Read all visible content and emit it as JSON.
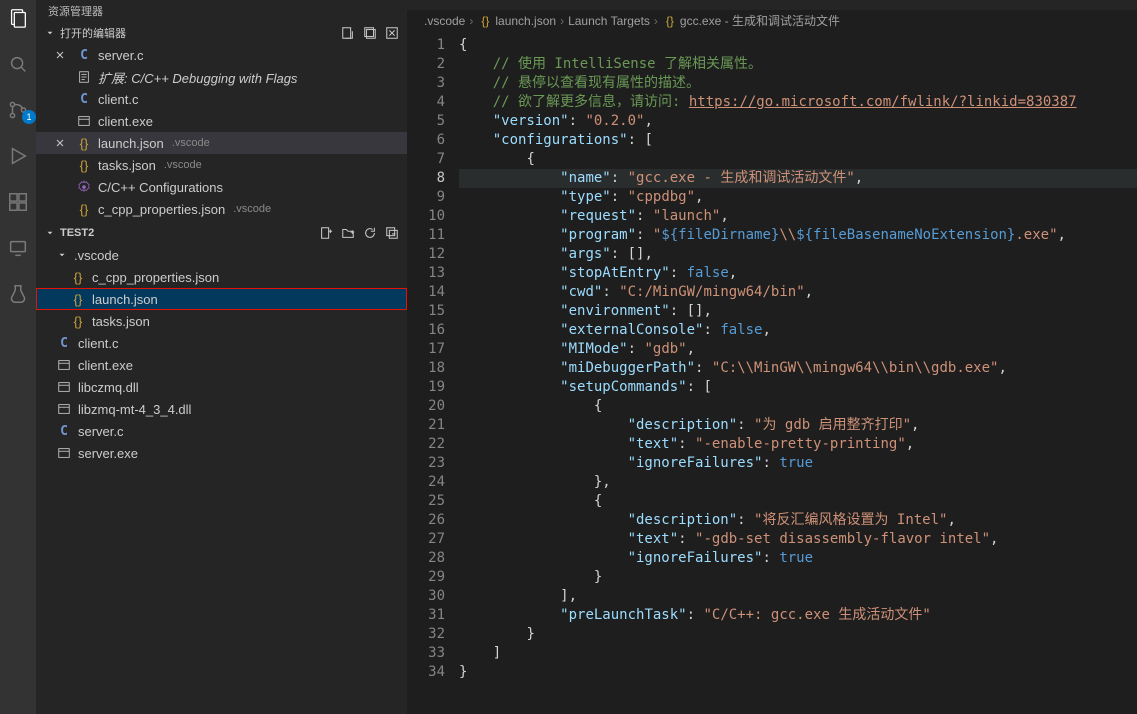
{
  "activity": {
    "badge_count": "1"
  },
  "sidebar": {
    "panel_title": "资源管理器",
    "open_editors_title": "打开的编辑器",
    "open_editors": [
      {
        "name": "server.c",
        "dim": "",
        "icon": "c",
        "close": true
      },
      {
        "name": "扩展: C/C++ Debugging with Flags",
        "dim": "",
        "icon": "md",
        "close": false,
        "italic": true
      },
      {
        "name": "client.c",
        "dim": "",
        "icon": "c",
        "close": false
      },
      {
        "name": "client.exe",
        "dim": "",
        "icon": "exe",
        "close": false
      },
      {
        "name": "launch.json",
        "dim": ".vscode",
        "icon": "json",
        "close": true,
        "active": true
      },
      {
        "name": "tasks.json",
        "dim": ".vscode",
        "icon": "json",
        "close": false
      },
      {
        "name": "C/C++ Configurations",
        "dim": "",
        "icon": "gear",
        "close": false
      },
      {
        "name": "c_cpp_properties.json",
        "dim": ".vscode",
        "icon": "json",
        "close": false
      }
    ],
    "folder_title": "TEST2",
    "tree": {
      "vscode": ".vscode",
      "items": [
        {
          "name": "c_cpp_properties.json",
          "icon": "json"
        },
        {
          "name": "launch.json",
          "icon": "json",
          "selected": true
        },
        {
          "name": "tasks.json",
          "icon": "json"
        }
      ],
      "root_items": [
        {
          "name": "client.c",
          "icon": "c"
        },
        {
          "name": "client.exe",
          "icon": "exe"
        },
        {
          "name": "libczmq.dll",
          "icon": "exe"
        },
        {
          "name": "libzmq-mt-4_3_4.dll",
          "icon": "exe"
        },
        {
          "name": "server.c",
          "icon": "c"
        },
        {
          "name": "server.exe",
          "icon": "exe"
        }
      ]
    }
  },
  "breadcrumbs": {
    "seg0": ".vscode",
    "seg1": "launch.json",
    "seg2": "Launch Targets",
    "seg3": "gcc.exe - 生成和调试活动文件"
  },
  "code": {
    "current_line": 8,
    "lines": [
      "{",
      "    // 使用 IntelliSense 了解相关属性。",
      "    // 悬停以查看现有属性的描述。",
      "    // 欲了解更多信息，请访问: https://go.microsoft.com/fwlink/?linkid=830387",
      "    \"version\": \"0.2.0\",",
      "    \"configurations\": [",
      "        {",
      "            \"name\": \"gcc.exe - 生成和调试活动文件\",",
      "            \"type\": \"cppdbg\",",
      "            \"request\": \"launch\",",
      "            \"program\": \"${fileDirname}\\\\${fileBasenameNoExtension}.exe\",",
      "            \"args\": [],",
      "            \"stopAtEntry\": false,",
      "            \"cwd\": \"C:/MinGW/mingw64/bin\",",
      "            \"environment\": [],",
      "            \"externalConsole\": false,",
      "            \"MIMode\": \"gdb\",",
      "            \"miDebuggerPath\": \"C:\\\\MinGW\\\\mingw64\\\\bin\\\\gdb.exe\",",
      "            \"setupCommands\": [",
      "                {",
      "                    \"description\": \"为 gdb 启用整齐打印\",",
      "                    \"text\": \"-enable-pretty-printing\",",
      "                    \"ignoreFailures\": true",
      "                },",
      "                {",
      "                    \"description\": \"将反汇编风格设置为 Intel\",",
      "                    \"text\": \"-gdb-set disassembly-flavor intel\",",
      "                    \"ignoreFailures\": true",
      "                }",
      "            ],",
      "            \"preLaunchTask\": \"C/C++: gcc.exe 生成活动文件\"",
      "        }",
      "    ]",
      "}"
    ]
  }
}
